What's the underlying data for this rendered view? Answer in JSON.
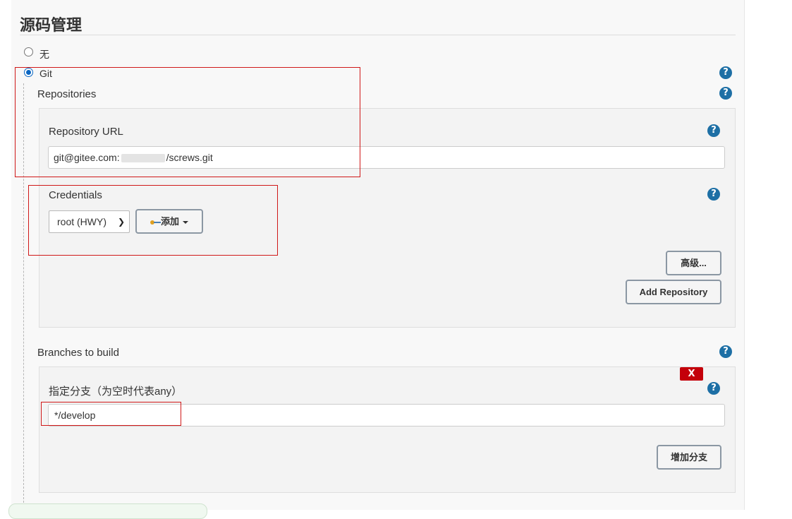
{
  "section": {
    "title": "源码管理"
  },
  "scm_options": [
    {
      "label": "无",
      "selected": false
    },
    {
      "label": "Git",
      "selected": true
    }
  ],
  "repositories": {
    "label": "Repositories",
    "repository_url": {
      "label": "Repository URL",
      "value_prefix": "git@gitee.com:",
      "value_suffix": "/screws.git"
    },
    "credentials": {
      "label": "Credentials",
      "selected": "root (HWY)",
      "add_button": "添加"
    },
    "advanced_button": "高级...",
    "add_repository_button": "Add Repository"
  },
  "branches": {
    "label": "Branches to build",
    "branch_specifier": {
      "label": "指定分支（为空时代表any）",
      "value": "*/develop"
    },
    "delete_button": "X",
    "add_branch_button": "增加分支"
  },
  "icons": {
    "help": "help-icon",
    "key": "key-icon",
    "dropdown": "chevron-down-icon"
  },
  "colors": {
    "help_icon": "#1d6fa5",
    "delete_button": "#c4000a",
    "annotation_box": "#d01818"
  }
}
